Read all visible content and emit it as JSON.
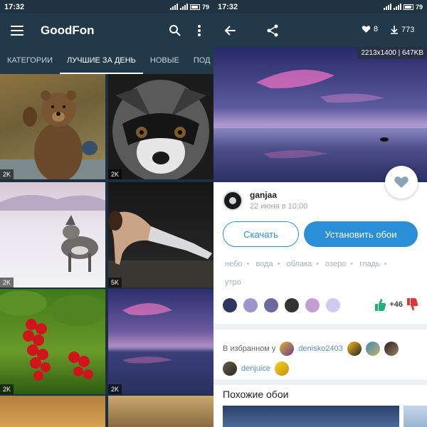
{
  "left": {
    "status": {
      "time": "17:32",
      "battery": "79"
    },
    "appbar": {
      "title": "GoodFon",
      "icons": [
        "menu-icon",
        "search-icon",
        "more-vertical-icon"
      ]
    },
    "tabs": [
      "КАТЕГОРИИ",
      "ЛУЧШИЕ ЗА ДЕНЬ",
      "НОВЫЕ",
      "ПОД"
    ],
    "active_tab": "ЛУЧШИЕ ЗА ДЕНЬ",
    "tiles": [
      {
        "subject": "bear",
        "res": "2K"
      },
      {
        "subject": "raccoon",
        "res": "2K"
      },
      {
        "subject": "wolf",
        "res": "2K"
      },
      {
        "subject": "fitness",
        "res": "5K"
      },
      {
        "subject": "berries",
        "res": "2K"
      },
      {
        "subject": "lake",
        "res": "2K"
      }
    ]
  },
  "right": {
    "status": {
      "time": "17:32",
      "battery": "79"
    },
    "toolbar": {
      "likes": "8",
      "downloads": "773",
      "icons": [
        "back-arrow-icon",
        "share-icon",
        "heart-icon",
        "download-icon"
      ]
    },
    "image_info": "2213x1400 | 647KB",
    "author": {
      "name": "ganjaa",
      "date": "22 июня в 10:00"
    },
    "buttons": {
      "download": "Скачать",
      "set_wallpaper": "Установить обои"
    },
    "tags": [
      "небо",
      "вода",
      "облака",
      "озеро",
      "гладь",
      "утро"
    ],
    "colors": [
      "#313660",
      "#9b96cc",
      "#6c6a9c",
      "#343434",
      "#c39ed3",
      "#cfcdee"
    ],
    "rating": "+46",
    "favorites": {
      "label": "В избранном у",
      "users": [
        "denisko2403",
        "denjuice"
      ]
    },
    "similar_title": "Похожие обои"
  }
}
